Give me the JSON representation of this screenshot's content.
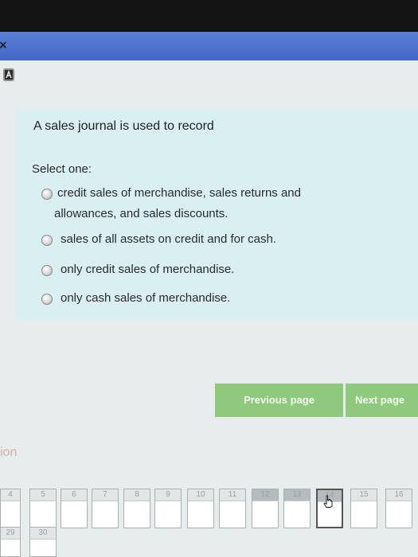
{
  "window": {
    "close_glyph": "×"
  },
  "question": {
    "text": "A sales journal is used to record",
    "prompt": "Select one:",
    "answers": [
      {
        "line1": "credit sales of merchandise, sales returns and",
        "line2": "allowances, and sales discounts."
      },
      {
        "line1": "sales of all assets on credit and for cash.",
        "line2": ""
      },
      {
        "line1": "only credit sales of merchandise.",
        "line2": ""
      },
      {
        "line1": "only cash sales of merchandise.",
        "line2": ""
      }
    ]
  },
  "navigation": {
    "previous_label": "Previous page",
    "next_label": "Next page"
  },
  "question_nav": {
    "section_label": "ion",
    "items": [
      "4",
      "5",
      "6",
      "7",
      "8",
      "9",
      "10",
      "11",
      "12",
      "13",
      "14",
      "15",
      "16",
      "29",
      "30"
    ]
  },
  "colors": {
    "top_bar": "#4a6fd0",
    "panel": "#d9eff2",
    "nav_button": "#8ec97e"
  },
  "icons": {
    "close": "close-icon",
    "app": "app-icon",
    "radio": "radio-icon",
    "cursor": "hand-cursor-icon"
  }
}
